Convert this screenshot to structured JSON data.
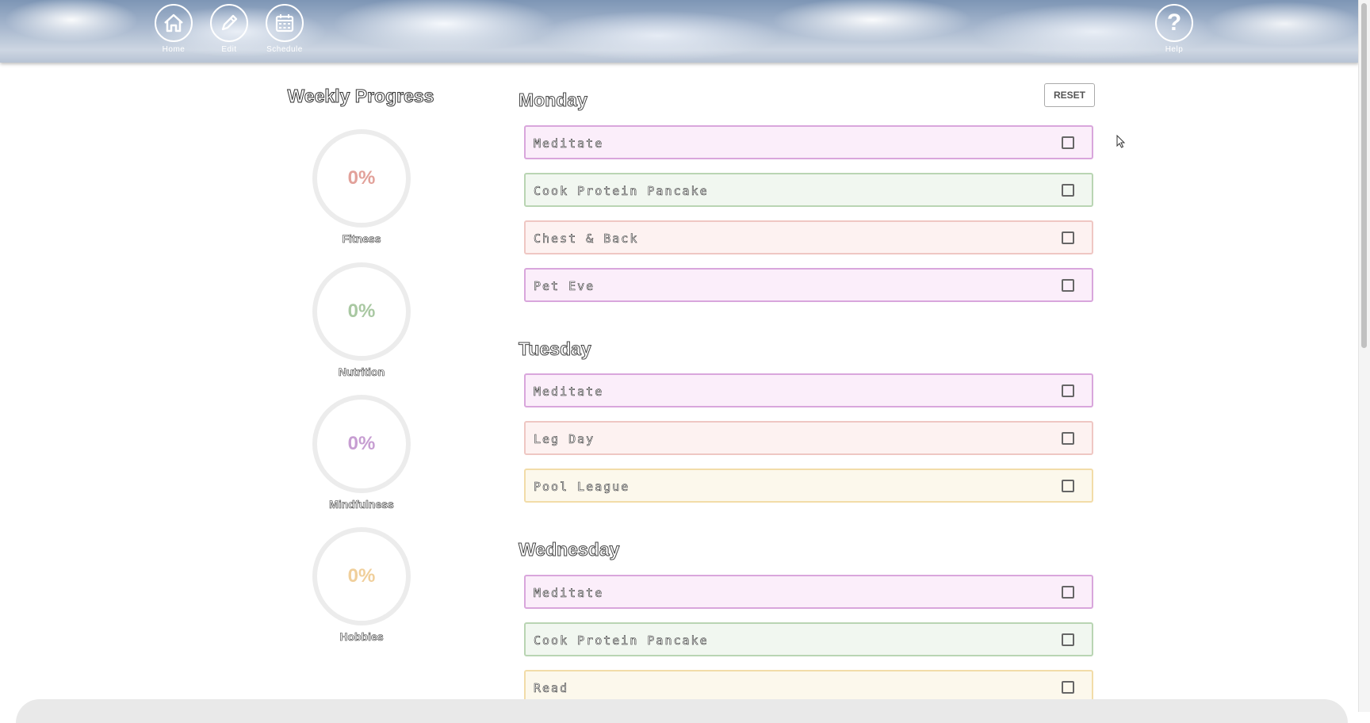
{
  "nav": {
    "home": "Home",
    "edit": "Edit",
    "schedule": "Schedule",
    "help": "Help",
    "help_symbol": "?"
  },
  "progress": {
    "title": "Weekly Progress",
    "items": [
      {
        "label": "Fitness",
        "percent": "0%",
        "color": "#e2a19a"
      },
      {
        "label": "Nutrition",
        "percent": "0%",
        "color": "#a9c8a2"
      },
      {
        "label": "Mindfulness",
        "percent": "0%",
        "color": "#c79ed2"
      },
      {
        "label": "Hobbies",
        "percent": "0%",
        "color": "#f0cf9b"
      }
    ]
  },
  "reset_label": "RESET",
  "days": [
    {
      "name": "Monday",
      "tasks": [
        {
          "label": "Meditate",
          "category": "Mindfulness"
        },
        {
          "label": "Cook Protein Pancake",
          "category": "Nutrition"
        },
        {
          "label": "Chest & Back",
          "category": "Fitness"
        },
        {
          "label": "Pet Eve",
          "category": "Mindfulness"
        }
      ]
    },
    {
      "name": "Tuesday",
      "tasks": [
        {
          "label": "Meditate",
          "category": "Mindfulness"
        },
        {
          "label": "Leg Day",
          "category": "Fitness"
        },
        {
          "label": "Pool League",
          "category": "Hobbies"
        }
      ]
    },
    {
      "name": "Wednesday",
      "tasks": [
        {
          "label": "Meditate",
          "category": "Mindfulness"
        },
        {
          "label": "Cook Protein Pancake",
          "category": "Nutrition"
        },
        {
          "label": "Read",
          "category": "Hobbies"
        }
      ]
    }
  ],
  "category_colors": {
    "Mindfulness": {
      "bg": "#fbeefa",
      "border": "#d9a6dc"
    },
    "Nutrition": {
      "bg": "#f1f7f0",
      "border": "#b9d5b3"
    },
    "Fitness": {
      "bg": "#fdf2f1",
      "border": "#efc7c3"
    },
    "Hobbies": {
      "bg": "#fcf8ec",
      "border": "#f2dca8"
    }
  }
}
